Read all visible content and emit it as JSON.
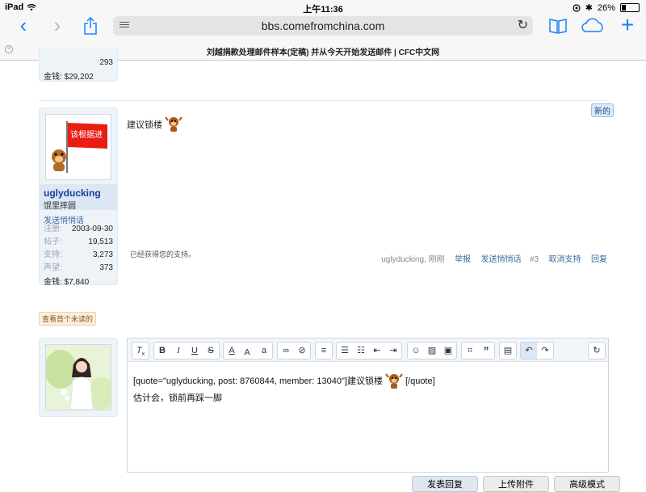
{
  "status": {
    "device": "iPad",
    "time": "上午11:36",
    "battery": "26%",
    "battery_level": 0.26
  },
  "browser": {
    "url": "bbs.comefromchina.com",
    "page_title": "刘越捐款处理邮件样本(定稿) 并从今天开始发送邮件 | CFC中文网"
  },
  "prev_user": {
    "stat_value": "293",
    "money": "金钱: $29,202"
  },
  "post": {
    "new_badge": "新的",
    "author": "uglyducking",
    "title": "馄里摔圆",
    "flag_text": "该根据进",
    "pm_link": "发送悄悄话",
    "stats": [
      {
        "label": "注册:",
        "value": "2003-09-30"
      },
      {
        "label": "帖子:",
        "value": "19,513"
      },
      {
        "label": "支持:",
        "value": "3,273"
      },
      {
        "label": "声望:",
        "value": "373"
      }
    ],
    "money": "金钱: $7,840",
    "body": "建议锁楼",
    "support_note": "已经获得您的支持。",
    "meta": "uglyducking, 刚刚",
    "actions": {
      "report": "举报",
      "pm": "发送悄悄话",
      "number": "#3",
      "unsupport": "取消支持",
      "reply": "回复"
    }
  },
  "first_unread": "查看首个未读的",
  "editor": {
    "quote_line": "[quote=\"uglyducking, post: 8760844, member: 13040\"]建议锁楼",
    "quote_end": "[/quote]",
    "line2": "估计会，锁前再踩一脚",
    "buttons": {
      "submit": "发表回复",
      "attach": "上传附件",
      "advanced": "高级模式"
    }
  },
  "colors": {
    "ios_blue": "#1a82fb",
    "author_blue": "#1a3c9c",
    "link_blue": "#3b6aa0"
  }
}
